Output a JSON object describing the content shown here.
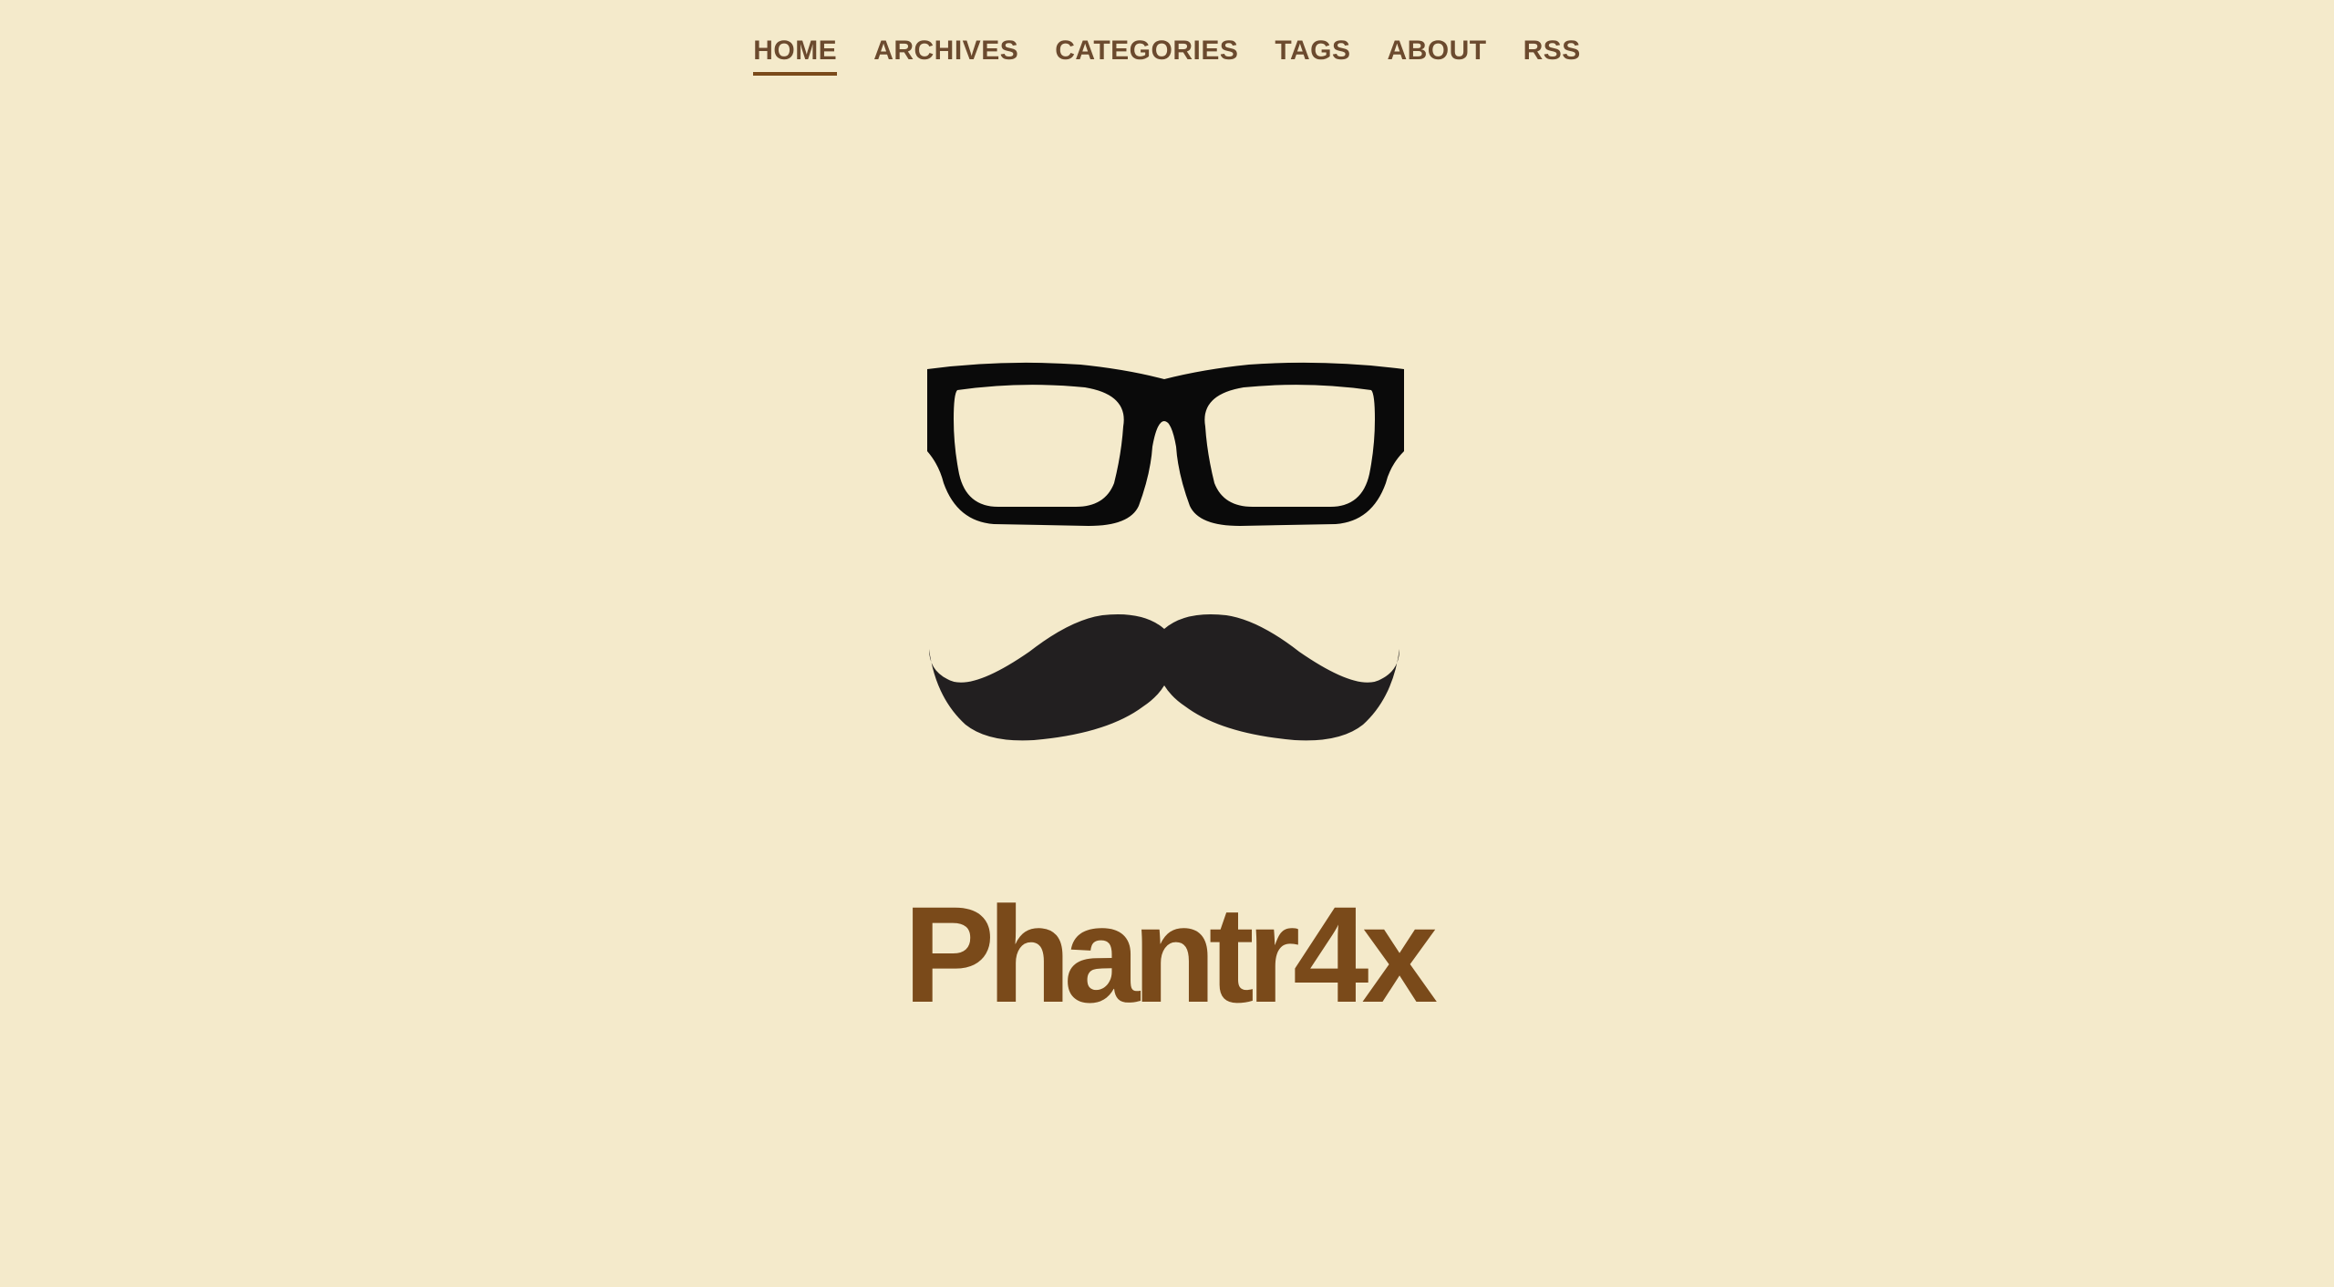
{
  "nav": {
    "items": [
      {
        "label": "HOME",
        "active": true
      },
      {
        "label": "ARCHIVES"
      },
      {
        "label": "CATEGORIES"
      },
      {
        "label": "TAGS"
      },
      {
        "label": "ABOUT"
      },
      {
        "label": "RSS"
      }
    ]
  },
  "hero": {
    "title": "Phantr4x",
    "logo_icons": [
      "glasses-icon",
      "mustache-icon"
    ]
  },
  "colors": {
    "background": "#f4eacb",
    "nav_text": "#6b4a2e",
    "title": "#7a4a1a",
    "icon": "#221f20"
  }
}
